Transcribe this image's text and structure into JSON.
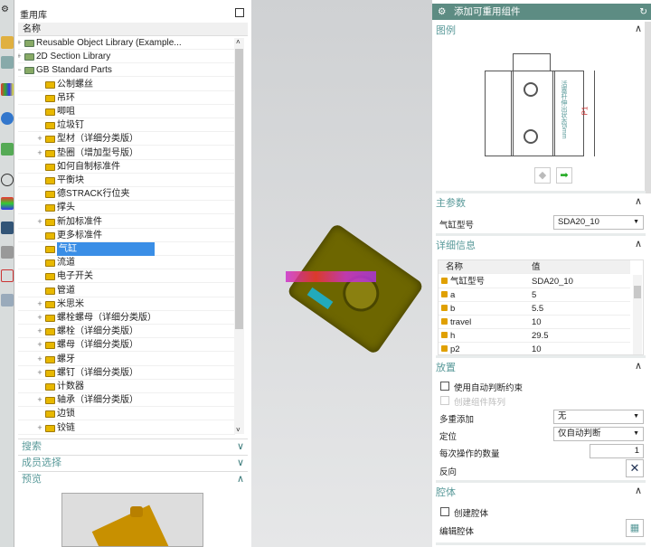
{
  "library": {
    "title": "重用库",
    "column": "名称",
    "items": [
      {
        "label": "Reusable Object Library (Example...",
        "level": 0,
        "expand": "+",
        "icon": "library"
      },
      {
        "label": "2D Section Library",
        "level": 0,
        "expand": "+",
        "icon": "library"
      },
      {
        "label": "GB Standard Parts",
        "level": 0,
        "expand": "−",
        "icon": "library"
      },
      {
        "label": "公制螺丝",
        "level": 1,
        "expand": ""
      },
      {
        "label": "吊环",
        "level": 1,
        "expand": ""
      },
      {
        "label": "唧咀",
        "level": 1,
        "expand": ""
      },
      {
        "label": "垃圾钉",
        "level": 1,
        "expand": ""
      },
      {
        "label": "型材（详细分类版）",
        "level": 1,
        "expand": "+"
      },
      {
        "label": "垫圈（增加型号版）",
        "level": 1,
        "expand": "+"
      },
      {
        "label": "如何自制标准件",
        "level": 1,
        "expand": ""
      },
      {
        "label": "平衡块",
        "level": 1,
        "expand": ""
      },
      {
        "label": "德STRACK行位夹",
        "level": 1,
        "expand": ""
      },
      {
        "label": "撑头",
        "level": 1,
        "expand": ""
      },
      {
        "label": "新加标准件",
        "level": 1,
        "expand": "+"
      },
      {
        "label": "更多标准件",
        "level": 1,
        "expand": ""
      },
      {
        "label": "气缸",
        "level": 1,
        "expand": "",
        "selected": true
      },
      {
        "label": "流道",
        "level": 1,
        "expand": ""
      },
      {
        "label": "电子开关",
        "level": 1,
        "expand": ""
      },
      {
        "label": "管道",
        "level": 1,
        "expand": ""
      },
      {
        "label": "米思米",
        "level": 1,
        "expand": "+"
      },
      {
        "label": "螺栓螺母（详细分类版）",
        "level": 1,
        "expand": "+"
      },
      {
        "label": "螺栓（详细分类版）",
        "level": 1,
        "expand": "+"
      },
      {
        "label": "螺母（详细分类版）",
        "level": 1,
        "expand": "+"
      },
      {
        "label": "螺牙",
        "level": 1,
        "expand": "+"
      },
      {
        "label": "螺钉（详细分类版）",
        "level": 1,
        "expand": "+"
      },
      {
        "label": "计数器",
        "level": 1,
        "expand": ""
      },
      {
        "label": "轴承（详细分类版）",
        "level": 1,
        "expand": "+"
      },
      {
        "label": "边锁",
        "level": 1,
        "expand": ""
      },
      {
        "label": "铰链",
        "level": 1,
        "expand": "+"
      }
    ],
    "sections": {
      "search": "搜索",
      "member": "成员选择",
      "preview": "预览"
    }
  },
  "dialog": {
    "title": "添加可重用组件",
    "legend": {
      "header": "图例",
      "dim_label": "P1",
      "drawing_note": "活塞杆伸出状态5mm"
    },
    "main_params": {
      "header": "主参数",
      "label": "气缸型号",
      "value": "SDA20_10"
    },
    "details": {
      "header": "详细信息",
      "col_name": "名称",
      "col_value": "值",
      "rows": [
        {
          "name": "气缸型号",
          "value": "SDA20_10"
        },
        {
          "name": "a",
          "value": "5"
        },
        {
          "name": "b",
          "value": "5.5"
        },
        {
          "name": "travel",
          "value": "10"
        },
        {
          "name": "h",
          "value": "29.5"
        },
        {
          "name": "p2",
          "value": "10"
        }
      ]
    },
    "placement": {
      "header": "放置",
      "auto_constraint": "使用自动判断约束",
      "create_array": "创建组件阵列",
      "multi_add_label": "多重添加",
      "multi_add_value": "无",
      "position_label": "定位",
      "position_value": "仅自动判断",
      "count_label": "每次操作的数量",
      "count_value": "1",
      "reverse_label": "反向"
    },
    "cavity": {
      "header": "腔体",
      "create": "创建腔体",
      "edit": "编辑腔体"
    }
  },
  "colors": {
    "title_bar": "#5d8c83",
    "selection": "#3a8ee6",
    "section_text": "#5a9a9a"
  }
}
